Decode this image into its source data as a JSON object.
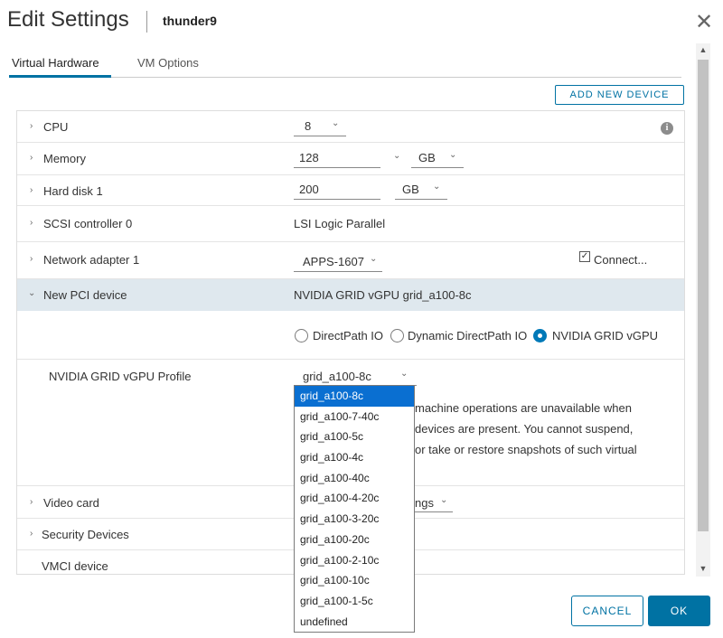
{
  "dialog": {
    "title": "Edit Settings",
    "vm_name": "thunder9",
    "close_glyph": "✕"
  },
  "tabs": [
    {
      "label": "Virtual Hardware",
      "active": true
    },
    {
      "label": "VM Options",
      "active": false
    }
  ],
  "add_device_label": "ADD NEW DEVICE",
  "hardware": {
    "cpu": {
      "label": "CPU",
      "value": "8"
    },
    "memory": {
      "label": "Memory",
      "value": "128",
      "unit": "GB"
    },
    "hard_disk": {
      "label": "Hard disk 1",
      "value": "200",
      "unit": "GB"
    },
    "scsi": {
      "label": "SCSI controller 0",
      "value": "LSI Logic Parallel"
    },
    "network": {
      "label": "Network adapter 1",
      "value": "APPS-1607",
      "connect_label": "Connect...",
      "connected": true
    },
    "pci": {
      "label": "New PCI device",
      "value": "NVIDIA GRID vGPU grid_a100-8c",
      "radio_options": [
        {
          "label": "DirectPath IO",
          "selected": false
        },
        {
          "label": "Dynamic DirectPath IO",
          "selected": false
        },
        {
          "label": "NVIDIA GRID vGPU",
          "selected": true
        }
      ],
      "profile_label": "NVIDIA GRID vGPU Profile",
      "profile_value": "grid_a100-8c",
      "note_lines": [
        "machine operations are unavailable when",
        "devices are present. You cannot suspend,",
        "or take or restore snapshots of such virtual"
      ]
    },
    "video_card": {
      "label": "Video card",
      "value_fragment": "ngs"
    },
    "security_devices": {
      "label": "Security Devices"
    },
    "vmci": {
      "label": "VMCI device"
    }
  },
  "profile_options": [
    "grid_a100-8c",
    "grid_a100-7-40c",
    "grid_a100-5c",
    "grid_a100-4c",
    "grid_a100-40c",
    "grid_a100-4-20c",
    "grid_a100-3-20c",
    "grid_a100-20c",
    "grid_a100-2-10c",
    "grid_a100-10c",
    "grid_a100-1-5c",
    "undefined"
  ],
  "profile_selected_index": 0,
  "footer": {
    "cancel_label": "CANCEL",
    "ok_label": "OK"
  },
  "colors": {
    "accent": "#0072a3",
    "selected_option": "#0a6fd1",
    "expanded_row": "#dfe8ee"
  },
  "icons": {
    "caret_right": "›",
    "caret_down": "⌄",
    "dropdown": "⌄",
    "info": "i",
    "scroll_up": "▲",
    "scroll_down": "▼",
    "check": "✓"
  }
}
